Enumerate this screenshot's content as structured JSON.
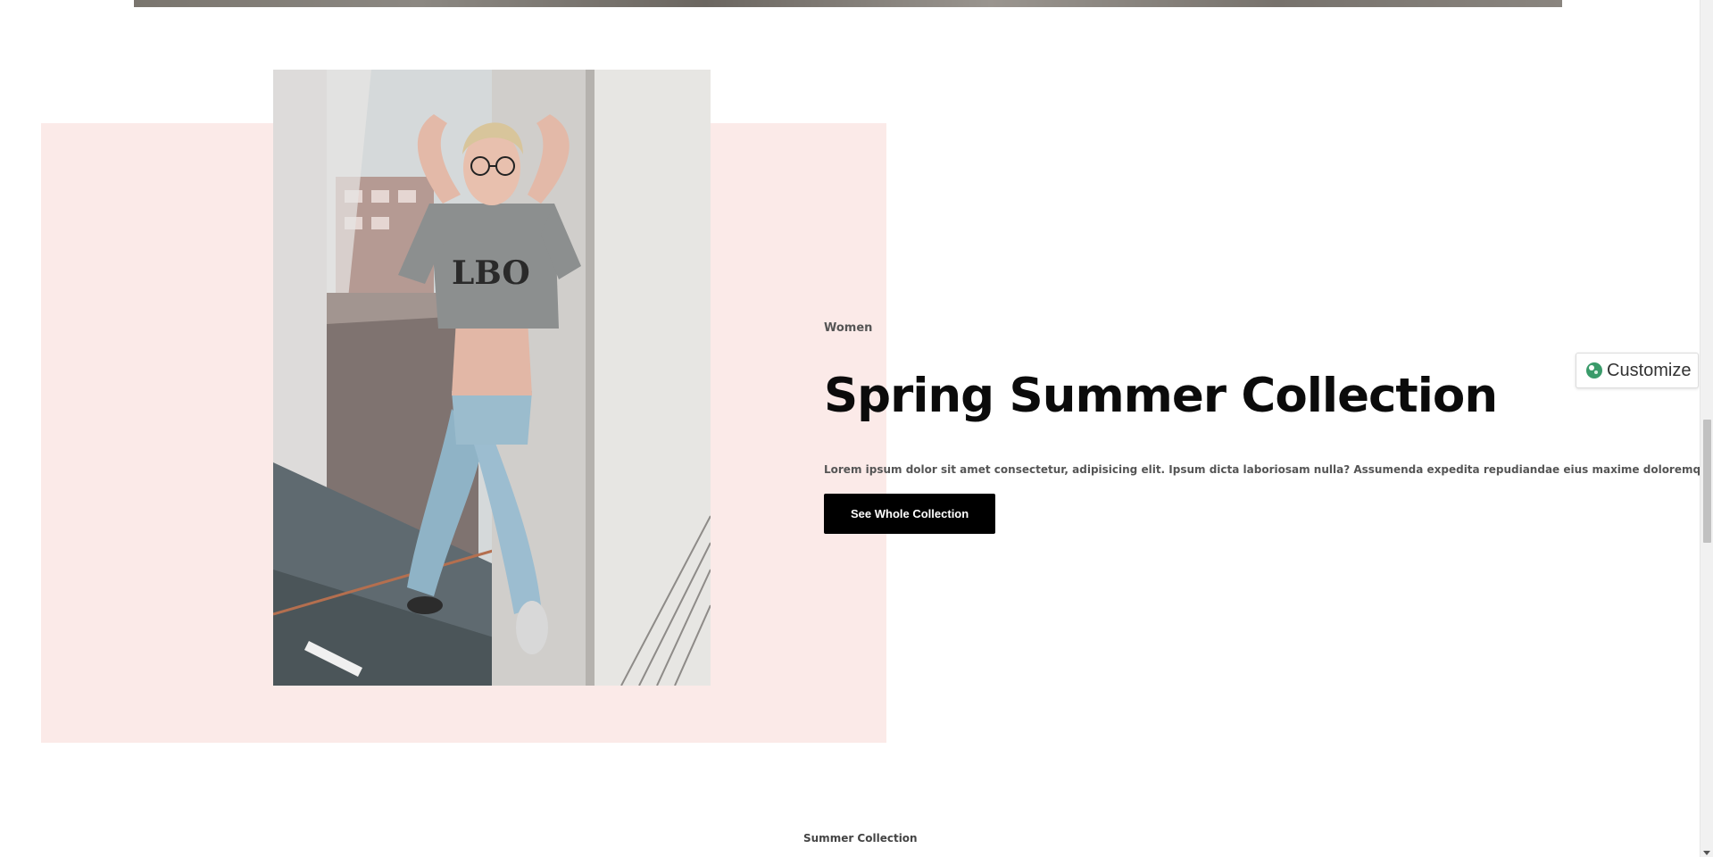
{
  "hero": {
    "eyebrow": "Women",
    "title": "Spring Summer Collection",
    "description": "Lorem ipsum dolor sit amet consectetur, adipisicing elit. Ipsum dicta laboriosam nulla? Assumenda expedita repudiandae eius maxime doloremque itaque ea!",
    "cta_label": "See Whole Collection",
    "photo_icon": "model-photo-image"
  },
  "customize": {
    "label": "Customize",
    "icon": "palette-icon"
  },
  "next_section": {
    "label": "Summer Collection"
  },
  "colors": {
    "panel_background": "#fbeae8",
    "cta_background": "#000000",
    "cta_text": "#ffffff"
  }
}
